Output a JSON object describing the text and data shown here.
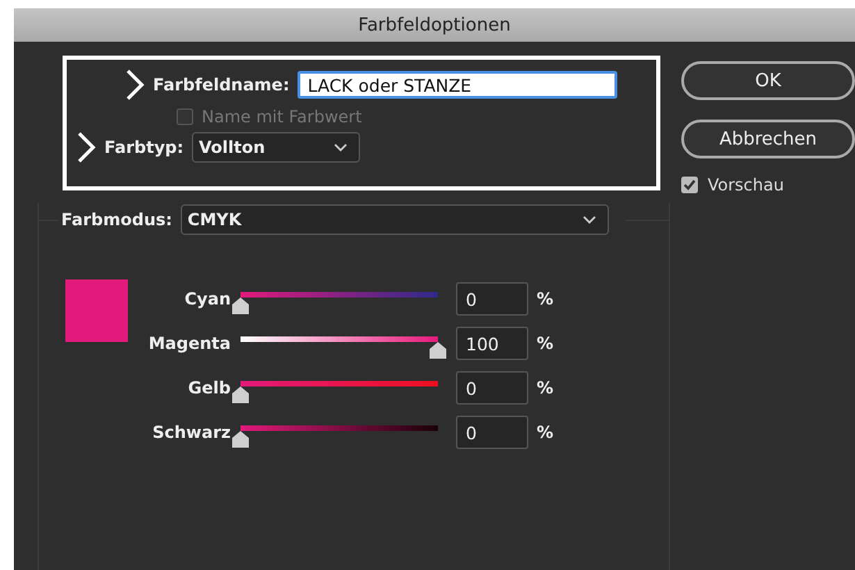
{
  "window": {
    "title": "Farbfeldoptionen"
  },
  "swatch_name": {
    "label": "Farbfeldname:",
    "value": "LACK oder STANZE"
  },
  "name_with_value": {
    "label": "Name mit Farbwert",
    "checked": false,
    "disabled": true
  },
  "color_type": {
    "label": "Farbtyp:",
    "value": "Vollton"
  },
  "buttons": [
    "OK",
    "Abbrechen"
  ],
  "preview": {
    "label": "Vorschau",
    "checked": true
  },
  "color_mode": {
    "label": "Farbmodus:",
    "value": "CMYK"
  },
  "channels": [
    {
      "name": "Cyan",
      "level": 0,
      "value": "0",
      "unit": "%"
    },
    {
      "name": "Magenta",
      "level": 1,
      "value": "100",
      "unit": "%"
    },
    {
      "name": "Gelb",
      "level": 0,
      "value": "0",
      "unit": "%"
    },
    {
      "name": "Schwarz",
      "level": 0,
      "value": "0",
      "unit": "%"
    }
  ]
}
